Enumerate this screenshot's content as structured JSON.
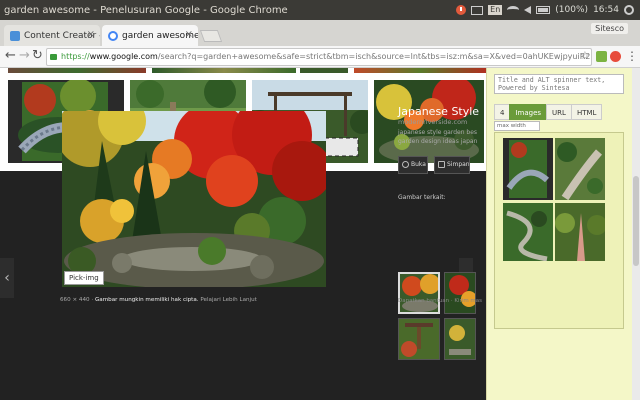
{
  "os": {
    "window_title": "garden awesome - Penelusuran Google - Google Chrome",
    "keyboard": "En",
    "battery": "(100%)",
    "time": "16:54"
  },
  "tabs": [
    {
      "label": "Content Creator - E",
      "close": "×"
    },
    {
      "label": "garden awesome",
      "close": "×"
    }
  ],
  "profile": "Sitesco",
  "toolbar": {
    "back": "←",
    "forward": "→",
    "reload": "↻",
    "url_scheme": "https://",
    "url_host": "www.google.com",
    "url_path": "/search?q=garden+awesome&safe=strict&tbm=isch&source=lnt&tbs=isz:m&sa=X&ved=0ahUKEwjpyuiR2rfdAhXFgIBKHYZXCBQQpwUIH...",
    "star": "☆",
    "menu": "⋮"
  },
  "preview": {
    "title": "Japanese Style",
    "source": "modernriverside.com",
    "description": "japanese style garden bes garden design ideas japan",
    "visit_button": "Buka",
    "save_button": "Simpan",
    "related_label": "Gambar terkait:",
    "pick_label": "Pick-img",
    "dimensions": "660 × 440",
    "copyright": "Gambar mungkin memiliki hak cipta.",
    "learn_more": "Pelajari Lebih Lanjut",
    "footer": "Dapatkan bantuan  ·  Kirim mas",
    "left_arrow": "‹",
    "right_arrow": "›"
  },
  "side_panel": {
    "textarea_placeholder": "Title and ALT spinner text,\nPowered by Sintesa",
    "tabs": [
      "4",
      "Images",
      "URL",
      "HTML"
    ],
    "active_tab": "Images",
    "max_width_placeholder": "max width"
  },
  "colors": {
    "os_bar": "#3b3a36",
    "tab_strip": "#d6d5d1",
    "preview_bg": "#222222",
    "side_panel": "#f4f7c8",
    "active_tab": "#6a9b3a"
  }
}
